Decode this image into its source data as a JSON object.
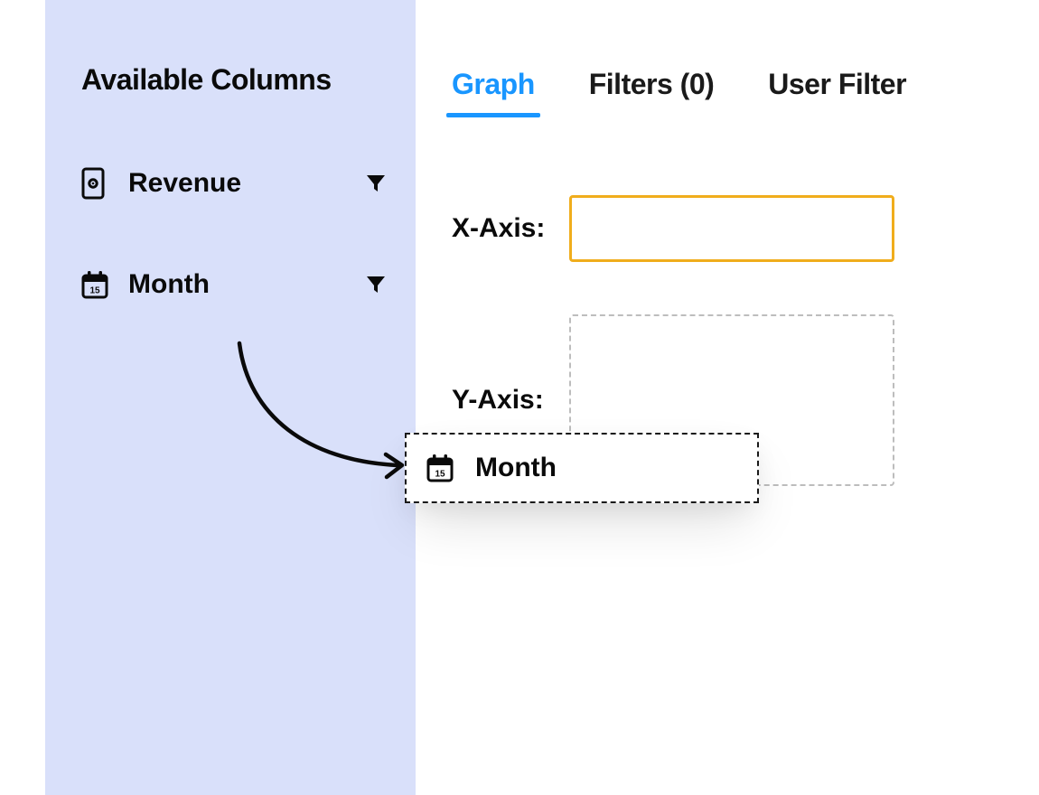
{
  "sidebar": {
    "title": "Available Columns",
    "columns": [
      {
        "label": "Revenue",
        "icon": "money-icon"
      },
      {
        "label": "Month",
        "icon": "calendar-icon"
      }
    ]
  },
  "tabs": [
    {
      "label": "Graph",
      "active": true
    },
    {
      "label": "Filters (0)",
      "active": false
    },
    {
      "label": "User Filter",
      "active": false
    }
  ],
  "axes": {
    "x_label": "X-Axis:",
    "y_label": "Y-Axis:"
  },
  "drag_ghost": {
    "label": "Month",
    "icon": "calendar-icon"
  },
  "colors": {
    "accent_blue": "#1996ff",
    "highlight_yellow": "#f0ad1c",
    "sidebar_bg": "#d9e0fa"
  }
}
